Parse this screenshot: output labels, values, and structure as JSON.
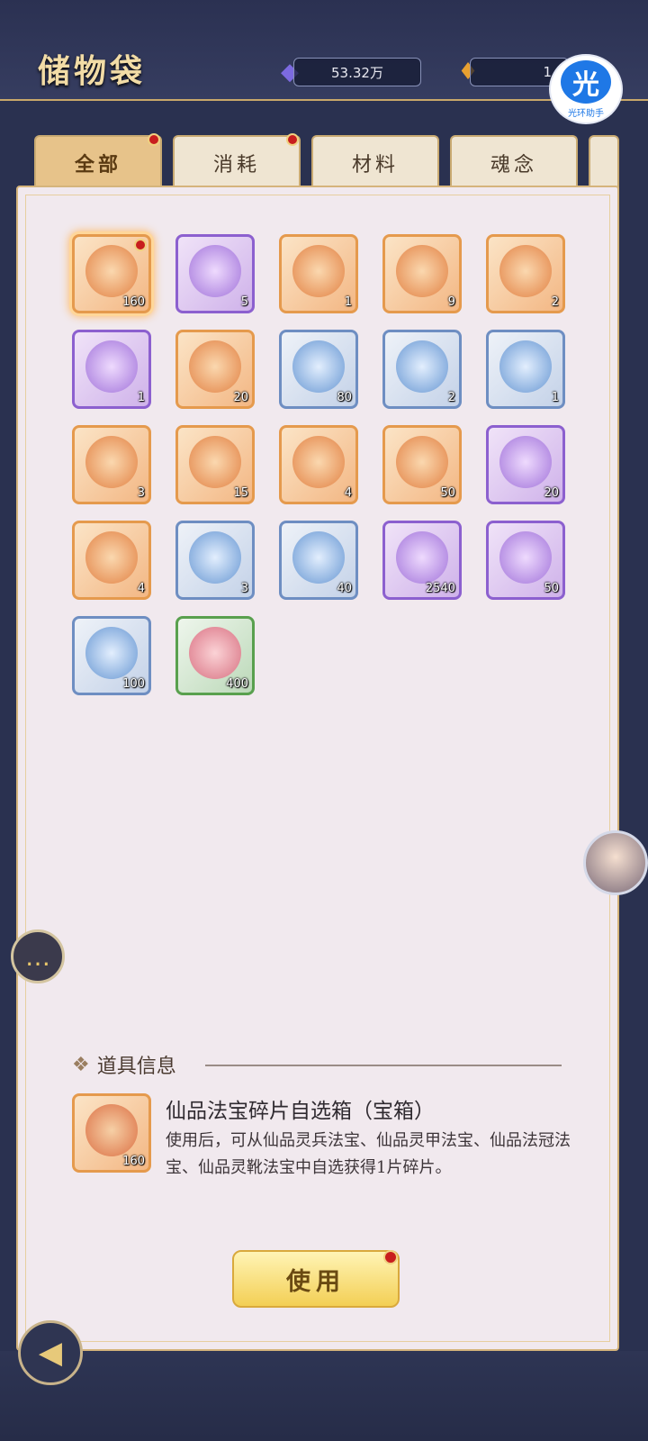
{
  "header": {
    "title": "储物袋",
    "currency_1": {
      "value": "53.32万",
      "icon": "spirit-jade-icon",
      "color": "#7c6ae0"
    },
    "currency_2": {
      "value": "1",
      "icon": "flame-gem-icon",
      "color": "#e8a030"
    },
    "overlay_badge": {
      "glyph": "光",
      "label": "光环助手",
      "color": "#1f78e6"
    }
  },
  "tabs": [
    {
      "label": "全部",
      "active": true,
      "red_dot": true
    },
    {
      "label": "消耗",
      "active": false,
      "red_dot": true
    },
    {
      "label": "材料",
      "active": false,
      "red_dot": false
    },
    {
      "label": "魂念",
      "active": false,
      "red_dot": false
    }
  ],
  "items": [
    {
      "count": "160",
      "rarity": "orange",
      "icon": "treasure-chest-icon",
      "selected": true,
      "red_dot": true
    },
    {
      "count": "5",
      "rarity": "purple",
      "icon": "purple-spirit-flame-icon"
    },
    {
      "count": "1",
      "rarity": "orange",
      "icon": "red-crown-icon"
    },
    {
      "count": "9",
      "rarity": "orange",
      "icon": "portrait-scroll-icon"
    },
    {
      "count": "2",
      "rarity": "orange",
      "icon": "sword-orb-icon"
    },
    {
      "count": "1",
      "rarity": "purple",
      "icon": "lotus-figure-icon"
    },
    {
      "count": "20",
      "rarity": "orange",
      "icon": "bronze-scroll-icon"
    },
    {
      "count": "80",
      "rarity": "blue",
      "icon": "jade-scroll-icon"
    },
    {
      "count": "2",
      "rarity": "blue",
      "icon": "porcelain-vase-icon"
    },
    {
      "count": "1",
      "rarity": "blue",
      "icon": "porcelain-vase-icon"
    },
    {
      "count": "3",
      "rarity": "orange",
      "icon": "jade-talisman-icon"
    },
    {
      "count": "15",
      "rarity": "orange",
      "icon": "bagua-talisman-icon"
    },
    {
      "count": "4",
      "rarity": "orange",
      "icon": "golden-dragon-icon"
    },
    {
      "count": "50",
      "rarity": "orange",
      "icon": "fire-gem-pedestal-icon"
    },
    {
      "count": "20",
      "rarity": "purple",
      "icon": "pink-gem-pedestal-icon"
    },
    {
      "count": "4",
      "rarity": "orange",
      "icon": "beast-statue-icon"
    },
    {
      "count": "3",
      "rarity": "blue",
      "icon": "blue-orb-icon"
    },
    {
      "count": "40",
      "rarity": "blue",
      "icon": "jade-crystal-icon"
    },
    {
      "count": "2540",
      "rarity": "purple",
      "icon": "violet-flame-crystal-icon"
    },
    {
      "count": "50",
      "rarity": "purple",
      "icon": "amethyst-crystal-icon"
    },
    {
      "count": "100",
      "rarity": "blue",
      "icon": "soul-egg-icon"
    },
    {
      "count": "400",
      "rarity": "green",
      "icon": "coral-icon"
    }
  ],
  "info": {
    "heading": "道具信息",
    "item_name": "仙品法宝碎片自选箱（宝箱）",
    "item_count": "160",
    "description": "使用后，可从仙品灵兵法宝、仙品灵甲法宝、仙品法冠法宝、仙品灵靴法宝中自选获得1片碎片。",
    "use_label": "使用"
  },
  "side": {
    "chat_icon": "chat-bubble-icon",
    "avatar_icon": "character-avatar-icon"
  },
  "footer": {
    "back_icon": "back-arrow-icon"
  }
}
